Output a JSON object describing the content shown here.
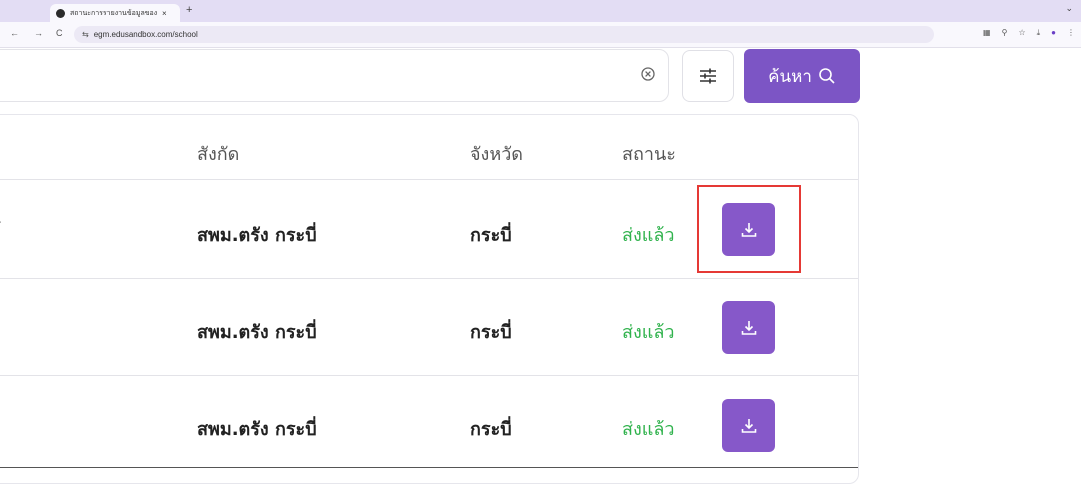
{
  "browser": {
    "tab_title": "สถานะการรายงานข้อมูลของ รร.",
    "tab_close": "×",
    "new_tab": "+",
    "tab_menu": "⌄",
    "url": "egm.edusandbox.com/school",
    "nav": {
      "back": "←",
      "forward": "→",
      "reload": "C"
    },
    "site_info_icon": "⇆",
    "toolbar_icons": [
      "translate-icon",
      "zoom-icon",
      "bookmark-star-icon",
      "download-icon",
      "profile-icon",
      "more-icon"
    ],
    "toolbar_glyphs": [
      "▦",
      "⚲",
      "☆",
      "⤓",
      "●",
      "⋮"
    ]
  },
  "search": {
    "search_label": "ค้นหา",
    "search_icon": "search-icon",
    "clear_icon": "clear-circle-icon",
    "filter_icon": "filter-sliders-icon"
  },
  "table": {
    "columns": [
      "สังกัด",
      "จังหวัด",
      "สถานะ"
    ],
    "rows": [
      {
        "name_partial": "์",
        "affiliation": "สพม.ตรัง กระบี่",
        "province": "กระบี่",
        "status": "ส่งแล้ว"
      },
      {
        "name_partial": "",
        "affiliation": "สพม.ตรัง กระบี่",
        "province": "กระบี่",
        "status": "ส่งแล้ว"
      },
      {
        "name_partial": "",
        "affiliation": "สพม.ตรัง กระบี่",
        "province": "กระบี่",
        "status": "ส่งแล้ว"
      }
    ],
    "action_icon": "download-icon"
  },
  "colors": {
    "accent": "#7c55c5",
    "download_button": "#8658c9",
    "status_sent": "#2fb24c",
    "highlight": "#e53935"
  }
}
